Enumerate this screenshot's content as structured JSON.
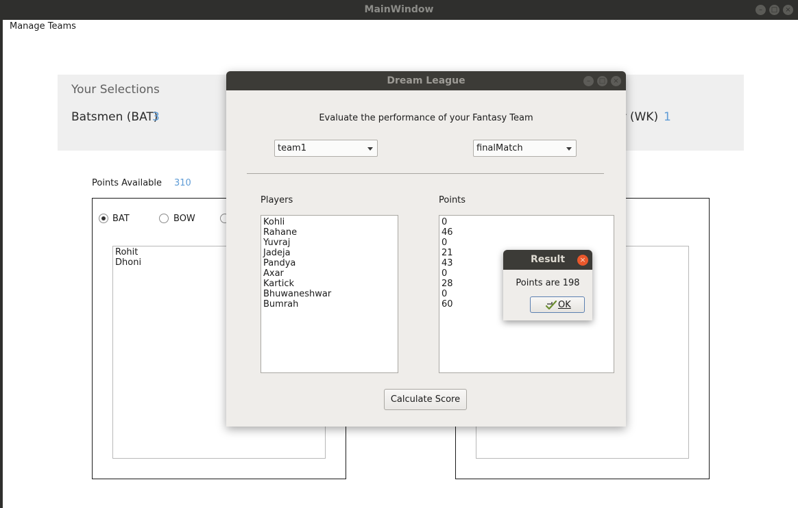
{
  "main_window": {
    "title": "MainWindow",
    "menu": {
      "manage_teams": "Manage Teams"
    }
  },
  "selections": {
    "title": "Your Selections",
    "bat_label": "Batsmen (BAT)",
    "bat_count": "3",
    "wk_label": "er (WK)",
    "wk_count": "1"
  },
  "points_available": {
    "label": "Points Available",
    "value": "310"
  },
  "role_filter": {
    "options": [
      "BAT",
      "BOW"
    ],
    "selected": "BAT"
  },
  "selected_players": [
    "Rohit",
    "Dhoni"
  ],
  "dialog": {
    "title": "Dream League",
    "heading": "Evaluate the performance of your Fantasy Team",
    "team_combo": "team1",
    "match_combo": "finalMatch",
    "players_label": "Players",
    "points_label": "Points",
    "players": [
      "Kohli",
      "Rahane",
      "Yuvraj",
      "Jadeja",
      "Pandya",
      "Axar",
      "Kartick",
      "Bhuwaneshwar",
      "Bumrah"
    ],
    "points": [
      "0",
      "46",
      "0",
      "21",
      "43",
      "0",
      "28",
      "0",
      "60"
    ],
    "calculate_button": "Calculate Score"
  },
  "result": {
    "title": "Result",
    "message": "Points are 198",
    "ok_button": "OK"
  },
  "colors": {
    "titlebar": "#2f2f2d",
    "dialog_bg": "#efedea",
    "accent_blue": "#5d9bd6",
    "close_orange": "#e9572b"
  }
}
